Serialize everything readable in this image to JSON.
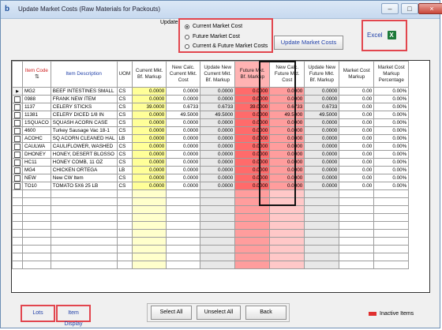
{
  "window": {
    "title": "Update Market Costs (Raw Materials for Packouts)",
    "logo": "b"
  },
  "update": {
    "label": "Update:",
    "options": [
      "Current Market Cost",
      "Future Market Cost",
      "Current & Future Market Costs"
    ],
    "selected": 0,
    "button": "Update Market Costs"
  },
  "excel": {
    "label": "Excel",
    "icon": "excel-icon"
  },
  "grid": {
    "columns": [
      "",
      "Item Code",
      "Item Description",
      "UOM",
      "Current Mkt. Bf. Markup",
      "New Calc. Current Mkt. Cost",
      "Update New Current Mkt. Bf. Markup",
      "Future Mkt. Bf. Markup",
      "New Calc. Future Mkt. Cost",
      "Update New Future Mkt. Bf. Markup",
      "Market Cost Markup",
      "Market Cost Markup Percentage"
    ],
    "rows": [
      {
        "code": "MG2",
        "desc": "BEEF INTESTINES SMALL",
        "uom": "CS",
        "c1": "0.0000",
        "c2": "0.0000",
        "c3": "0.0000",
        "c4": "0.0000",
        "c5": "0.0000",
        "c6": "0.0000",
        "c7": "0.00",
        "c8": "0.00%"
      },
      {
        "code": "0988",
        "desc": "FRANK NEW ITEM",
        "uom": "CS",
        "c1": "0.0000",
        "c2": "0.0000",
        "c3": "0.0000",
        "c4": "0.0000",
        "c5": "0.0000",
        "c6": "0.0000",
        "c7": "0.00",
        "c8": "0.00%"
      },
      {
        "code": "1137",
        "desc": "CELERY STICKS",
        "uom": "CS",
        "c1": "39.0000",
        "c2": "0.6733",
        "c3": "0.6733",
        "c4": "39.0000",
        "c5": "0.6733",
        "c6": "0.6733",
        "c7": "0.00",
        "c8": "0.00%"
      },
      {
        "code": "11381",
        "desc": "CELERY DICED 1/8 IN",
        "uom": "CS",
        "c1": "0.0000",
        "c2": "49.5000",
        "c3": "49.5000",
        "c4": "0.0000",
        "c5": "49.5000",
        "c6": "49.5000",
        "c7": "0.00",
        "c8": "0.00%"
      },
      {
        "code": "1SQUACO",
        "desc": "SQUASH ACORN CASE",
        "uom": "CS",
        "c1": "0.0000",
        "c2": "0.0000",
        "c3": "0.0000",
        "c4": "0.0000",
        "c5": "0.0000",
        "c6": "0.0000",
        "c7": "0.00",
        "c8": "0.00%"
      },
      {
        "code": "4600",
        "desc": "Turkey Sausage Vac 18-1",
        "uom": "CS",
        "c1": "0.0000",
        "c2": "0.0000",
        "c3": "0.0000",
        "c4": "0.0000",
        "c5": "0.0000",
        "c6": "0.0000",
        "c7": "0.00",
        "c8": "0.00%"
      },
      {
        "code": "ACOHC",
        "desc": "SQ ACORN CLEANED HAL",
        "uom": "LB",
        "c1": "0.0000",
        "c2": "0.0000",
        "c3": "0.0000",
        "c4": "0.0000",
        "c5": "0.0000",
        "c6": "0.0000",
        "c7": "0.00",
        "c8": "0.00%"
      },
      {
        "code": "CAULWA",
        "desc": "CAULIFLOWER, WASHED",
        "uom": "CS",
        "c1": "0.0000",
        "c2": "0.0000",
        "c3": "0.0000",
        "c4": "0.0000",
        "c5": "0.0000",
        "c6": "0.0000",
        "c7": "0.00",
        "c8": "0.00%"
      },
      {
        "code": "DHONEY",
        "desc": "HONEY, DESERT BLOSSO",
        "uom": "CS",
        "c1": "0.0000",
        "c2": "0.0000",
        "c3": "0.0000",
        "c4": "0.0000",
        "c5": "0.0000",
        "c6": "0.0000",
        "c7": "0.00",
        "c8": "0.00%"
      },
      {
        "code": "HC11",
        "desc": "HONEY COMB, 11 OZ",
        "uom": "CS",
        "c1": "0.0000",
        "c2": "0.0000",
        "c3": "0.0000",
        "c4": "0.0000",
        "c5": "0.0000",
        "c6": "0.0000",
        "c7": "0.00",
        "c8": "0.00%"
      },
      {
        "code": "MG4",
        "desc": "CHICKEN ORTEGA",
        "uom": "LB",
        "c1": "0.0000",
        "c2": "0.0000",
        "c3": "0.0000",
        "c4": "0.0000",
        "c5": "0.0000",
        "c6": "0.0000",
        "c7": "0.00",
        "c8": "0.00%"
      },
      {
        "code": "NEW",
        "desc": "New CW Item",
        "uom": "CS",
        "c1": "0.0000",
        "c2": "0.0000",
        "c3": "0.0000",
        "c4": "0.0000",
        "c5": "0.0000",
        "c6": "0.0000",
        "c7": "0.00",
        "c8": "0.00%"
      },
      {
        "code": "TO10",
        "desc": "TOMATO 5X6 25 LB",
        "uom": "CS",
        "c1": "0.0000",
        "c2": "0.0000",
        "c3": "0.0000",
        "c4": "0.0000",
        "c5": "0.0000",
        "c6": "0.0000",
        "c7": "0.00",
        "c8": "0.00%"
      }
    ]
  },
  "buttons": {
    "lots": "Lots",
    "item_display": "Item Display",
    "select_all": "Select All",
    "unselect_all": "Unselect All",
    "back": "Back"
  },
  "legend": {
    "label": "Inactive Items",
    "color": "#e0302f"
  }
}
